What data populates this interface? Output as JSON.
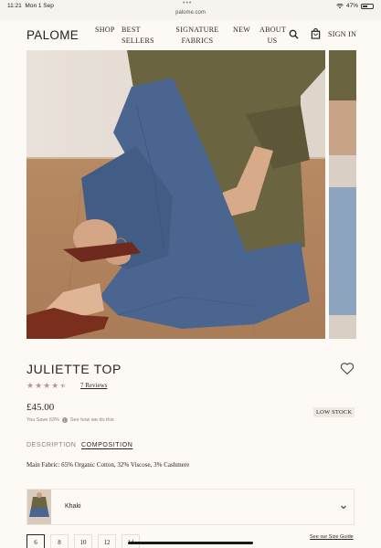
{
  "status": {
    "time": "11:21",
    "date": "Mon 1 Sep",
    "url": "palome.com",
    "battery": "47%",
    "battery_level": 0.47
  },
  "nav": {
    "logo": "PALOME",
    "items": [
      "SHOP",
      "BEST SELLERS",
      "SIGNATURE FABRICS",
      "NEW",
      "ABOUT US"
    ],
    "signin": "SIGN IN"
  },
  "product": {
    "title": "JULIETTE TOP",
    "rating": 4.5,
    "reviews": "7 Reviews",
    "price": "£45.00",
    "save_text": "You Save 63%",
    "save_link": "See how we do this",
    "stock": "LOW STOCK"
  },
  "tabs": {
    "description": "DESCRIPTION",
    "composition": "COMPOSITION"
  },
  "composition": "Main Fabric: 65% Organic Cotton, 32% Viscose, 3% Cashmere",
  "color": {
    "name": "Khaki",
    "swatch_color": "#6b6440"
  },
  "sizes": [
    "6",
    "8",
    "10",
    "12",
    "14"
  ],
  "selected_size": "6",
  "size_guide": "See our Size Guide",
  "colors": {
    "background": "#fdf9f5",
    "text": "#2b2522",
    "star": "#b99590",
    "top_khaki": "#6b6440",
    "jeans": "#4a6690"
  }
}
